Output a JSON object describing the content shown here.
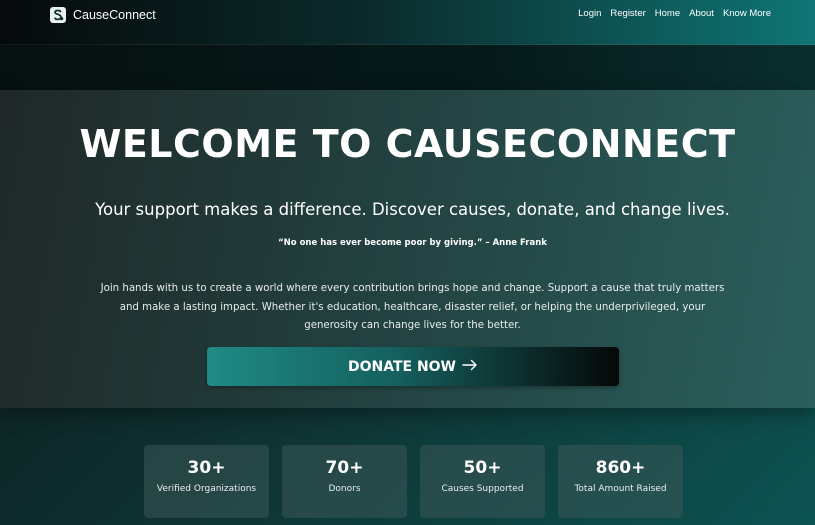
{
  "navbar": {
    "brand": "CauseConnect",
    "links": [
      "Login",
      "Register",
      "Home",
      "About",
      "Know More"
    ]
  },
  "hero": {
    "title": "WELCOME TO CAUSECONNECT",
    "subtitle": "Your support makes a difference. Discover causes, donate, and change lives.",
    "quote": "“No one has ever become poor by giving.” – Anne Frank",
    "body": "Join hands with us to create a world where every contribution brings hope and change. Support a cause that truly matters and make a lasting impact. Whether it's education, healthcare, disaster relief, or helping the underprivileged, your generosity can change lives for the better.",
    "cta": "DONATE NOW",
    "cta_icon": "arrow-right-icon"
  },
  "stats": [
    {
      "value": "30+",
      "label": "Verified Organizations"
    },
    {
      "value": "70+",
      "label": "Donors"
    },
    {
      "value": "50+",
      "label": "Causes Supported"
    },
    {
      "value": "860+",
      "label": "Total Amount Raised"
    }
  ],
  "colors": {
    "accent": "#1f8a85",
    "header_end": "#0f7575"
  }
}
